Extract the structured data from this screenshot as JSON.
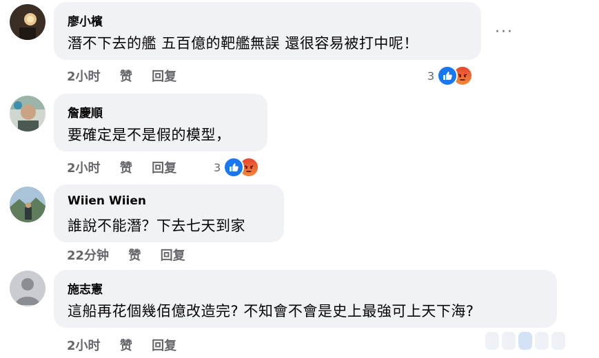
{
  "comments": [
    {
      "author": "廖小檳",
      "text": "潛不下去的艦 五百億的靶艦無誤 還很容易被打中呢！",
      "time": "2小时",
      "like_label": "赞",
      "reply_label": "回复",
      "reaction_count": "3"
    },
    {
      "author": "詹慶順",
      "text": "要確定是不是假的模型，",
      "time": "2小时",
      "like_label": "赞",
      "reply_label": "回复",
      "reaction_count": "3"
    },
    {
      "author": "Wiien Wiien",
      "text": "誰說不能潛？下去七天到家",
      "time": "22分钟",
      "like_label": "赞",
      "reply_label": "回复"
    },
    {
      "author": "施志憲",
      "text": "這船再花個幾佰億改造完? 不知會不會是史上最強可上天下海?",
      "time": "2小时",
      "like_label": "赞",
      "reply_label": "回复"
    }
  ],
  "more_menu": "···",
  "colors": {
    "bubble": "#f0f2f5",
    "like_blue": "#1877f2",
    "meta_gray": "#65676b"
  },
  "icons": [
    "more-options-icon",
    "like-reaction-icon",
    "angry-reaction-icon",
    "default-avatar-icon"
  ]
}
